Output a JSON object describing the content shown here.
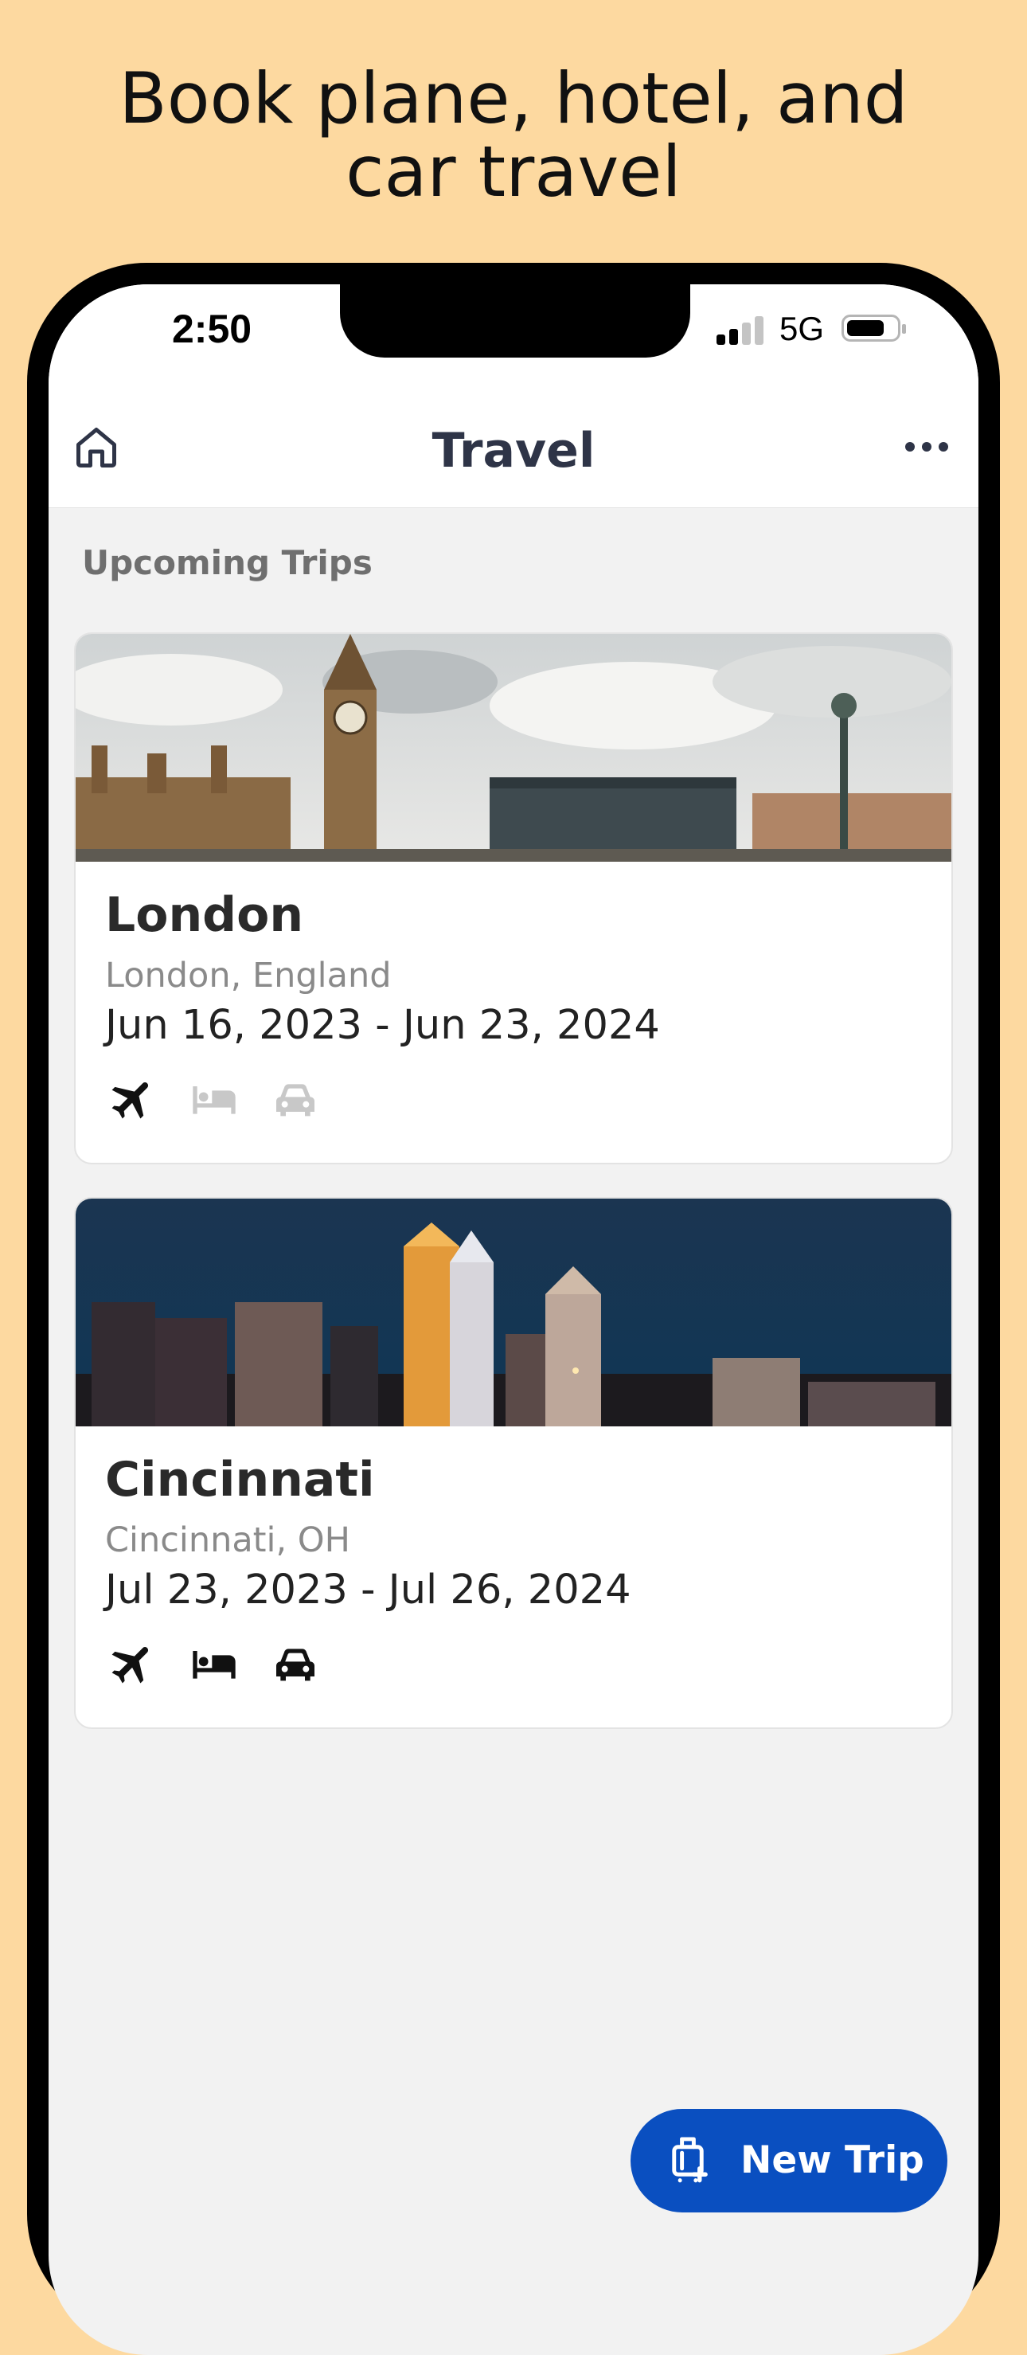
{
  "promo": {
    "headline_line1": "Book plane, hotel, and",
    "headline_line2": "car travel"
  },
  "status_bar": {
    "time": "2:50",
    "network": "5G"
  },
  "app_bar": {
    "title": "Travel",
    "home_icon": "home-icon",
    "more_icon": "more-horizontal-icon"
  },
  "section": {
    "label": "Upcoming Trips"
  },
  "trips": [
    {
      "name": "London",
      "location": "London, England",
      "dates": "Jun 16, 2023 - Jun 23, 2024",
      "image": "london-skyline-photo",
      "flight_booked": true,
      "hotel_booked": false,
      "car_booked": false
    },
    {
      "name": "Cincinnati",
      "location": "Cincinnati, OH",
      "dates": "Jul 23, 2023 - Jul 26, 2024",
      "image": "cincinnati-skyline-photo",
      "flight_booked": true,
      "hotel_booked": true,
      "car_booked": true
    }
  ],
  "fab": {
    "label": "New Trip",
    "icon": "luggage-plus-icon"
  },
  "colors": {
    "background": "#FDD9A0",
    "accent": "#0A4FC0",
    "title": "#2E3447",
    "icon_active": "#111111",
    "icon_inactive": "#C8C8C8"
  }
}
